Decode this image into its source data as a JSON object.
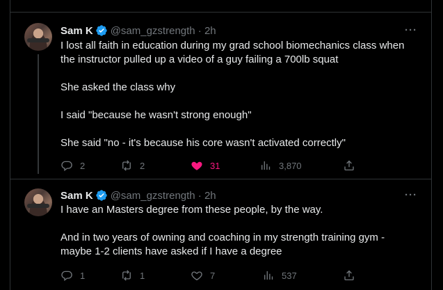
{
  "tweets": [
    {
      "author_name": "Sam K",
      "handle_time": "@sam_gzstrength · 2h",
      "more_label": "···",
      "lines": [
        "I lost all faith in education during my grad school biomechanics class when",
        "the instructor pulled up a video of a guy failing a 700lb squat",
        "She asked the class why",
        "I said \"because he wasn't strong enough\"",
        "She said \"no - it's because his core wasn't activated correctly\""
      ],
      "actions": {
        "replies": "2",
        "reposts": "2",
        "likes": "31",
        "views": "3,870"
      },
      "liked": true
    },
    {
      "author_name": "Sam K",
      "handle_time": "@sam_gzstrength · 2h",
      "more_label": "···",
      "lines": [
        "I have an Masters degree from these people, by the way.",
        "And in two years of owning and coaching in my strength training gym -",
        "maybe 1-2 clients have asked if I have a degree"
      ],
      "actions": {
        "replies": "1",
        "reposts": "1",
        "likes": "7",
        "views": "537"
      },
      "liked": false
    }
  ],
  "icons": [
    "verified-badge-icon",
    "reply-icon",
    "repost-icon",
    "like-icon",
    "views-icon",
    "share-icon"
  ],
  "colors": {
    "background": "#000000",
    "text": "#e7e9ea",
    "muted": "#71767b",
    "like": "#f91880",
    "verified": "#1d9bf0",
    "border": "#2f3336"
  }
}
